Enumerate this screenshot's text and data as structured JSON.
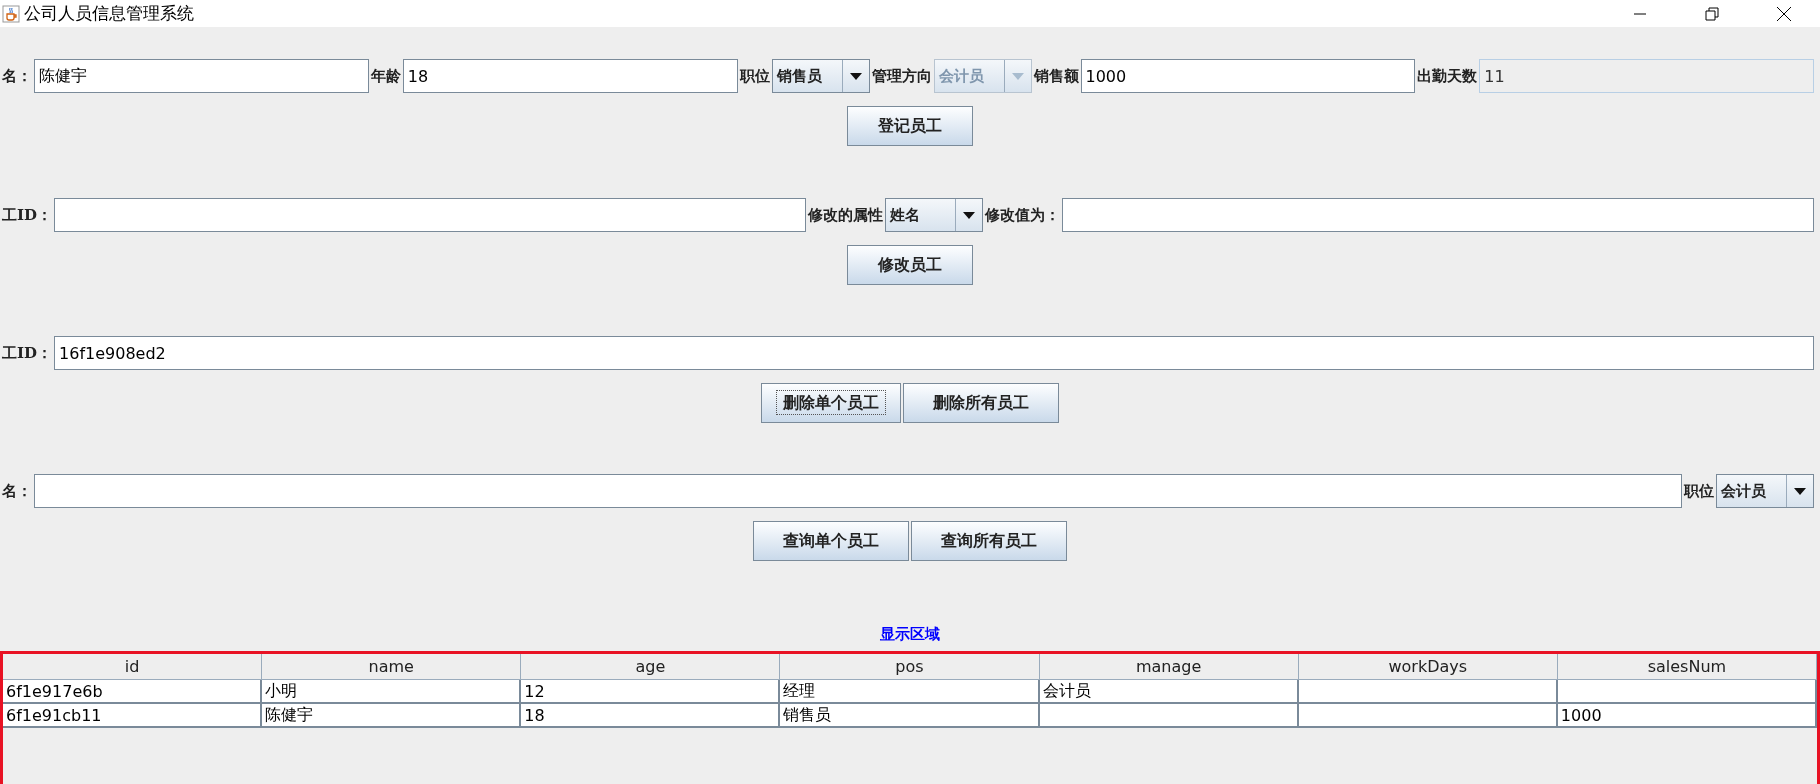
{
  "window": {
    "title": "公司人员信息管理系统"
  },
  "register": {
    "items": [
      {
        "kind": "text",
        "label": "名：",
        "value": "陈健宇",
        "disabled": false
      },
      {
        "kind": "text",
        "label": "年龄",
        "value": "18",
        "disabled": false
      },
      {
        "kind": "combo",
        "label": "职位",
        "value": "销售员",
        "disabled": false
      },
      {
        "kind": "combo",
        "label": "管理方向",
        "value": "会计员",
        "disabled": true
      },
      {
        "kind": "text",
        "label": "销售额",
        "value": "1000",
        "disabled": false
      },
      {
        "kind": "text",
        "label": "出勤天数",
        "value": "11",
        "disabled": true
      }
    ],
    "buttons": [
      {
        "label": "登记员工",
        "focused": false
      }
    ]
  },
  "modify": {
    "items": [
      {
        "kind": "text",
        "label": "工ID：",
        "value": "",
        "disabled": false
      },
      {
        "kind": "combo",
        "label": "修改的属性",
        "value": "姓名",
        "disabled": false
      },
      {
        "kind": "text",
        "label": "修改值为：",
        "value": "",
        "disabled": false
      }
    ],
    "buttons": [
      {
        "label": "修改员工",
        "focused": false
      }
    ]
  },
  "delete": {
    "items": [
      {
        "kind": "text",
        "label": "工ID：",
        "value": "16f1e908ed2",
        "disabled": false
      }
    ],
    "buttons": [
      {
        "label": "删除单个员工",
        "focused": true
      },
      {
        "label": "删除所有员工",
        "focused": false
      }
    ]
  },
  "query": {
    "items": [
      {
        "kind": "text",
        "label": "名：",
        "value": "",
        "disabled": false
      },
      {
        "kind": "combo",
        "label": "职位",
        "value": "会计员",
        "disabled": false
      }
    ],
    "buttons": [
      {
        "label": "查询单个员工",
        "focused": false
      },
      {
        "label": "查询所有员工",
        "focused": false
      }
    ]
  },
  "display": {
    "title": "显示区域",
    "columns": [
      "id",
      "name",
      "age",
      "pos",
      "manage",
      "workDays",
      "salesNum"
    ],
    "rows": [
      [
        "6f1e917e6b",
        "小明",
        "12",
        "经理",
        "会计员",
        "",
        ""
      ],
      [
        "6f1e91cb11",
        "陈健宇",
        "18",
        "销售员",
        "",
        "",
        "1000"
      ]
    ]
  }
}
